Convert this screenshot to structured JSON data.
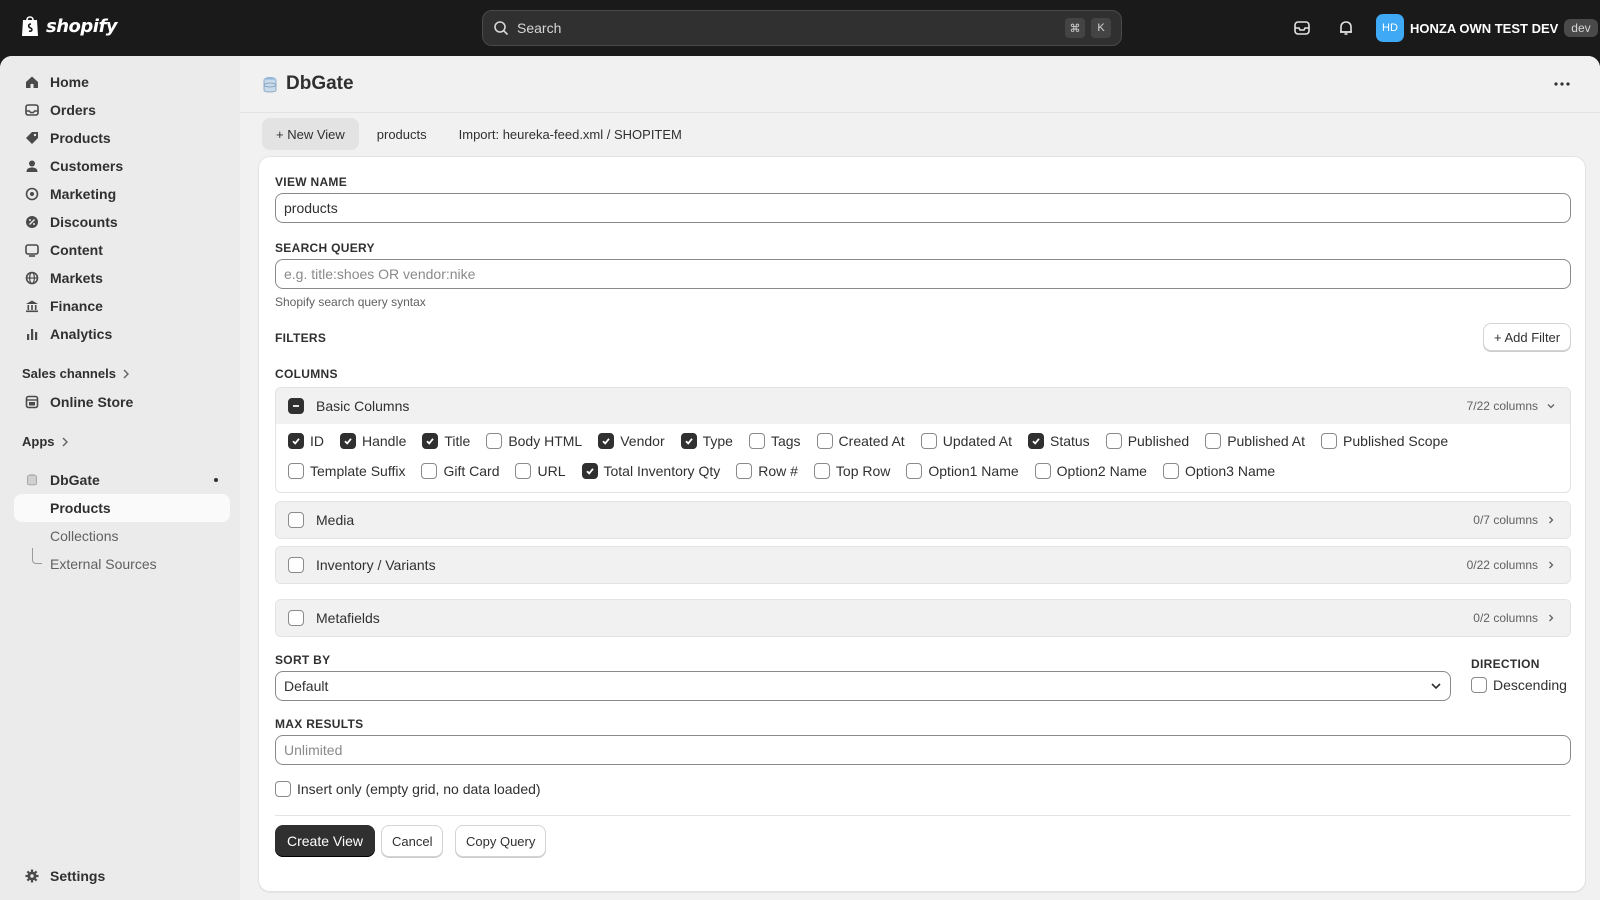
{
  "topbar": {
    "brand": "shopify",
    "search_placeholder": "Search",
    "shortcut_keys": [
      "⌘",
      "K"
    ],
    "store_initials": "HD",
    "store_name": "HONZA OWN TEST DEV",
    "env_badge": "dev",
    "avatar_color": "#3fa9f5"
  },
  "sidebar": {
    "items": [
      {
        "label": "Home",
        "icon": "home-icon"
      },
      {
        "label": "Orders",
        "icon": "inbox-icon"
      },
      {
        "label": "Products",
        "icon": "tag-icon"
      },
      {
        "label": "Customers",
        "icon": "person-icon"
      },
      {
        "label": "Marketing",
        "icon": "target-icon"
      },
      {
        "label": "Discounts",
        "icon": "discount-icon"
      },
      {
        "label": "Content",
        "icon": "content-icon"
      },
      {
        "label": "Markets",
        "icon": "globe-icon"
      },
      {
        "label": "Finance",
        "icon": "bank-icon"
      },
      {
        "label": "Analytics",
        "icon": "bar-chart-icon"
      }
    ],
    "sales_channels": "Sales channels",
    "online_store": "Online Store",
    "apps": "Apps",
    "app_name": "DbGate",
    "app_sub_items": [
      "Products",
      "Collections",
      "External Sources"
    ],
    "settings": "Settings"
  },
  "page": {
    "title": "DbGate",
    "tabs": [
      "+ New View",
      "products",
      "Import: heureka-feed.xml / SHOPITEM"
    ]
  },
  "form": {
    "view_name_label": "VIEW NAME",
    "view_name_value": "products",
    "search_query_label": "SEARCH QUERY",
    "search_query_placeholder": "e.g. title:shoes OR vendor:nike",
    "search_help": "Shopify search query syntax",
    "filters_label": "FILTERS",
    "add_filter": "+ Add Filter",
    "columns_label": "COLUMNS",
    "groups": [
      {
        "title": "Basic Columns",
        "count": "7/22 columns",
        "expanded": true,
        "options": [
          {
            "label": "ID",
            "checked": true
          },
          {
            "label": "Handle",
            "checked": true
          },
          {
            "label": "Title",
            "checked": true
          },
          {
            "label": "Body HTML",
            "checked": false
          },
          {
            "label": "Vendor",
            "checked": true
          },
          {
            "label": "Type",
            "checked": true
          },
          {
            "label": "Tags",
            "checked": false
          },
          {
            "label": "Created At",
            "checked": false
          },
          {
            "label": "Updated At",
            "checked": false
          },
          {
            "label": "Status",
            "checked": true
          },
          {
            "label": "Published",
            "checked": false
          },
          {
            "label": "Published At",
            "checked": false
          },
          {
            "label": "Published Scope",
            "checked": false
          },
          {
            "label": "Template Suffix",
            "checked": false
          },
          {
            "label": "Gift Card",
            "checked": false
          },
          {
            "label": "URL",
            "checked": false
          },
          {
            "label": "Total Inventory Qty",
            "checked": true
          },
          {
            "label": "Row #",
            "checked": false
          },
          {
            "label": "Top Row",
            "checked": false
          },
          {
            "label": "Option1 Name",
            "checked": false
          },
          {
            "label": "Option2 Name",
            "checked": false
          },
          {
            "label": "Option3 Name",
            "checked": false
          }
        ]
      },
      {
        "title": "Media",
        "count": "0/7 columns",
        "expanded": false
      },
      {
        "title": "Inventory / Variants",
        "count": "0/22 columns",
        "expanded": false
      },
      {
        "title": "Metafields",
        "count": "0/2 columns",
        "expanded": false
      }
    ],
    "sort_by_label": "SORT BY",
    "sort_by_value": "Default",
    "direction_label": "DIRECTION",
    "descending_label": "Descending",
    "max_results_label": "MAX RESULTS",
    "max_results_placeholder": "Unlimited",
    "insert_only_label": "Insert only (empty grid, no data loaded)",
    "create_view": "Create View",
    "cancel": "Cancel",
    "copy_query": "Copy Query"
  }
}
